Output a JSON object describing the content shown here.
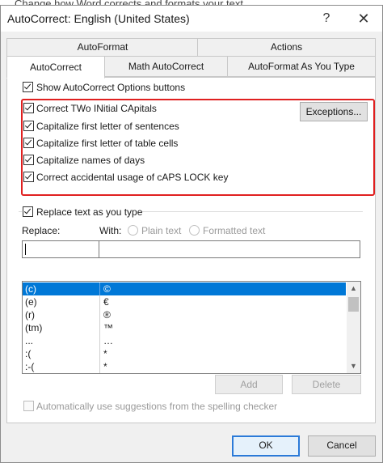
{
  "background_text": "Change how Word corrects and formats your text",
  "window": {
    "title": "AutoCorrect: English (United States)",
    "help_glyph": "?",
    "close_glyph": "✕"
  },
  "tabs": {
    "row1": [
      {
        "label": "AutoFormat"
      },
      {
        "label": "Actions"
      }
    ],
    "row2": [
      {
        "label": "AutoCorrect",
        "active": true
      },
      {
        "label": "Math AutoCorrect"
      },
      {
        "label": "AutoFormat As You Type"
      }
    ]
  },
  "options": {
    "show_buttons": "Show AutoCorrect Options buttons",
    "two_initial_caps": "Correct TWo INitial CApitals",
    "cap_sentences": "Capitalize first letter of sentences",
    "cap_table_cells": "Capitalize first letter of table cells",
    "cap_days": "Capitalize names of days",
    "caps_lock": "Correct accidental usage of cAPS LOCK key",
    "exceptions_button": "Exceptions..."
  },
  "replace_section": {
    "replace_as_you_type": "Replace text as you type",
    "replace_label": "Replace:",
    "with_label": "With:",
    "plain_text": "Plain text",
    "formatted_text": "Formatted text",
    "replace_value": "",
    "with_value": ""
  },
  "entries": [
    {
      "replace": "(c)",
      "with": "©"
    },
    {
      "replace": "(e)",
      "with": "€"
    },
    {
      "replace": "(r)",
      "with": "®"
    },
    {
      "replace": "(tm)",
      "with": "™"
    },
    {
      "replace": "...",
      "with": "…"
    },
    {
      "replace": ":(",
      "with": "*"
    },
    {
      "replace": ":-(",
      "with": "*"
    }
  ],
  "buttons": {
    "add": "Add",
    "delete": "Delete",
    "ok": "OK",
    "cancel": "Cancel"
  },
  "spelling_suggestions": "Automatically use suggestions from the spelling checker",
  "colors": {
    "highlight_border": "#e02020",
    "selection": "#0078d7",
    "default_button_border": "#2b7ad8"
  }
}
